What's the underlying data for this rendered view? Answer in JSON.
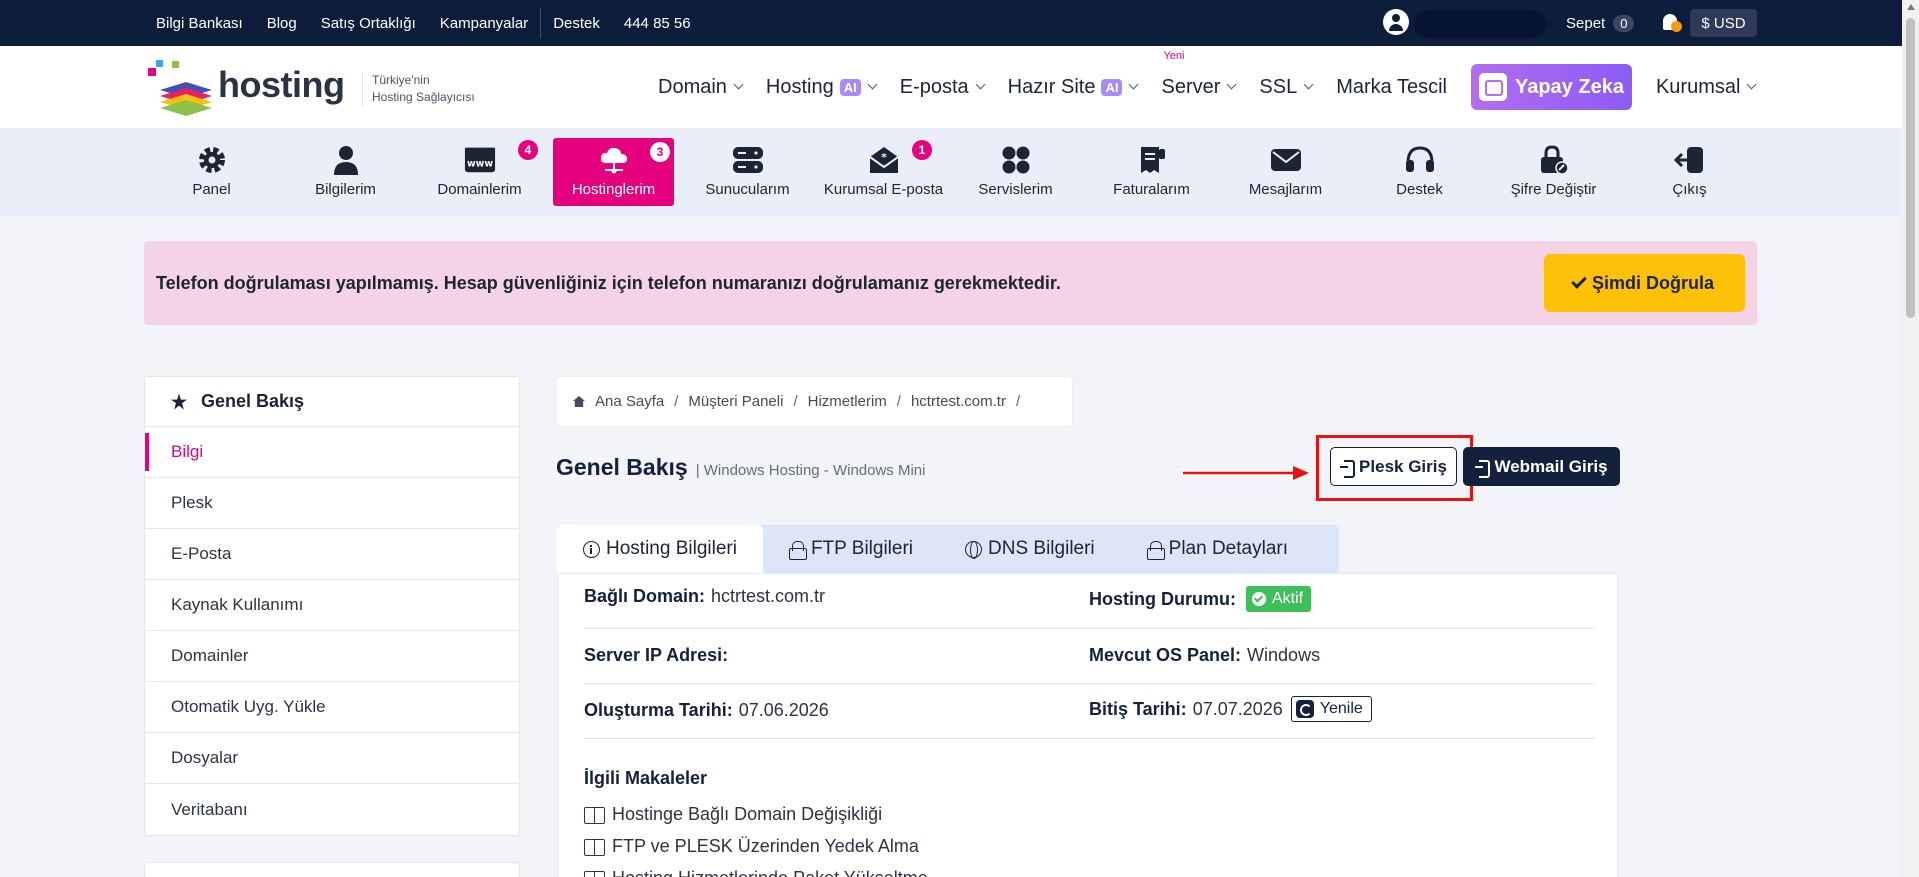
{
  "topbar": {
    "links": [
      "Bilgi Bankası",
      "Blog",
      "Satış Ortaklığı",
      "Kampanyalar"
    ],
    "support": "Destek",
    "phone": "444 85 56",
    "cart_label": "Sepet",
    "cart_count": "0",
    "currency": "$ USD"
  },
  "header": {
    "logo_text": "hosting",
    "tagline_1": "Türkiye'nin",
    "tagline_2": "Hosting Sağlayıcısı",
    "nav": {
      "domain": "Domain",
      "hosting": "Hosting",
      "hosting_badge": "AI",
      "eposta": "E-posta",
      "hazir_site": "Hazır Site",
      "hazir_badge": "AI",
      "server": "Server",
      "server_new": "Yeni",
      "ssl": "SSL",
      "marka": "Marka Tescil",
      "yapay": "Yapay Zeka",
      "kurumsal": "Kurumsal"
    }
  },
  "iconnav": {
    "panel": "Panel",
    "bilgilerim": "Bilgilerim",
    "domainlerim": "Domainlerim",
    "domainlerim_count": "4",
    "hostinglerim": "Hostinglerim",
    "hostinglerim_count": "3",
    "sunucularim": "Sunucularım",
    "eposta": "Kurumsal E-posta",
    "eposta_count": "1",
    "servislerim": "Servislerim",
    "faturalarim": "Faturalarım",
    "mesajlarim": "Mesajlarım",
    "destek": "Destek",
    "sifre": "Şifre Değiştir",
    "cikis": "Çıkış",
    "www_text": "www"
  },
  "alert": {
    "text": "Telefon doğrulaması yapılmamış. Hesap güvenliğiniz için telefon numaranızı doğrulamanız gerekmektedir.",
    "button": "Şimdi Doğrula"
  },
  "sidebar": {
    "title": "Genel Bakış",
    "items": [
      "Bilgi",
      "Plesk",
      "E-Posta",
      "Kaynak Kullanımı",
      "Domainler",
      "Otomatik Uyg. Yükle",
      "Dosyalar",
      "Veritabanı"
    ]
  },
  "breadcrumb": [
    "Ana Sayfa",
    "Müşteri Paneli",
    "Hizmetlerim",
    "hctrtest.com.tr"
  ],
  "page": {
    "title": "Genel Bakış",
    "subtitle": "| Windows Hosting - Windows Mini",
    "plesk_btn": "Plesk Giriş",
    "webmail_btn": "Webmail Giriş"
  },
  "tabs": [
    "Hosting Bilgileri",
    "FTP Bilgileri",
    "DNS Bilgileri",
    "Plan Detayları"
  ],
  "info": {
    "domain_label": "Bağlı Domain:",
    "domain_value": "hctrtest.com.tr",
    "status_label": "Hosting Durumu:",
    "status_value": "Aktif",
    "ip_label": "Server IP Adresi:",
    "os_label": "Mevcut OS Panel:",
    "os_value": "Windows",
    "created_label": "Oluşturma Tarihi:",
    "created_value": "07.06.2026",
    "end_label": "Bitiş Tarihi:",
    "end_value": "07.07.2026",
    "renew": "Yenile"
  },
  "articles": {
    "title": "İlgili Makaleler",
    "items": [
      "Hostinge Bağlı Domain Değişikliği",
      "FTP ve PLESK Üzerinden Yedek Alma",
      "Hosting Hizmetlerinde Paket Yükseltme"
    ]
  },
  "colors": {
    "navy": "#0f1d3d",
    "brand_pink": "#e5007e",
    "warning_yellow": "#ffc107",
    "success_green": "#3fbf5a",
    "annotation_red": "#e81212"
  }
}
